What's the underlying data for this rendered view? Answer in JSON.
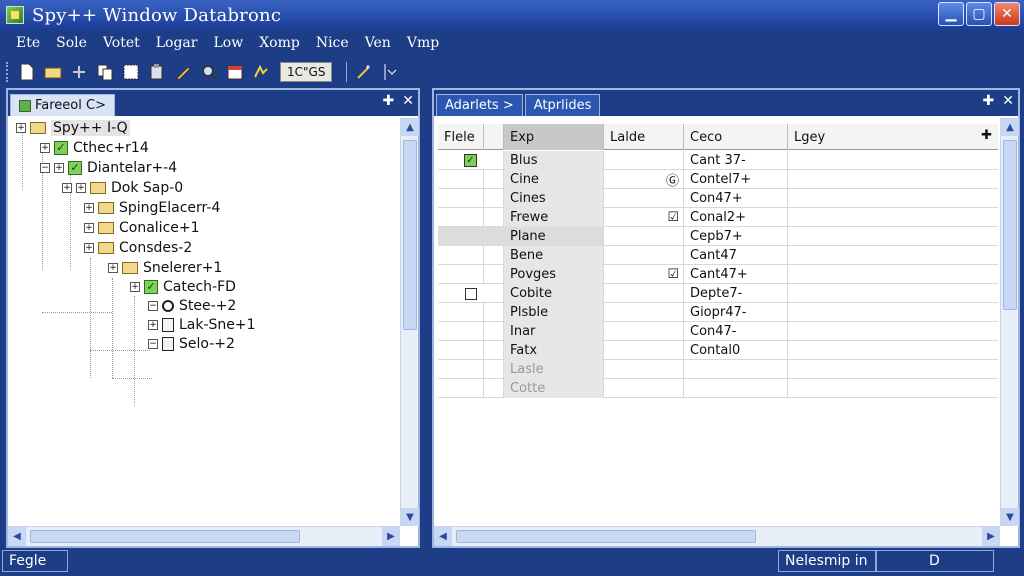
{
  "window": {
    "title": "Spy++ Window Databronc",
    "min_label": "▁",
    "max_label": "▢",
    "close_label": "✕"
  },
  "menu": [
    "Ete",
    "Sole",
    "Votet",
    "Logar",
    "Low",
    "Xomp",
    "Nice",
    "Ven",
    "Vmp"
  ],
  "toolbar": {
    "field_value": "1C\"GS",
    "icons": [
      "new-file-icon",
      "open-folder-icon",
      "plus-icon",
      "copy-icon",
      "window-icon",
      "paste-icon",
      "pencil-icon",
      "find-icon",
      "calendar-icon",
      "refresh-icon",
      "wand-icon",
      "dropdown-icon"
    ]
  },
  "left_panel": {
    "tab_label": "Fareeol C>",
    "ctrl_pin": "✚",
    "ctrl_close": "✕",
    "tree": [
      {
        "label": "Spy++ I-Q",
        "icon": "folder",
        "selected": true
      },
      {
        "label": "Cthec+r14",
        "icon": "check"
      },
      {
        "label": "Diantelar+-4",
        "icon": "check"
      },
      {
        "label": "Dok Sap-0",
        "icon": "folder"
      },
      {
        "label": "SpingElacerr-4",
        "icon": "folder"
      },
      {
        "label": "Conalice+1",
        "icon": "folder"
      },
      {
        "label": "Consdes-2",
        "icon": "folder"
      },
      {
        "label": "Snelerer+1",
        "icon": "folder"
      },
      {
        "label": "Catech-FD",
        "icon": "check"
      },
      {
        "label": "Stee-+2",
        "icon": "search"
      },
      {
        "label": "Lak-Sne+1",
        "icon": "doc"
      },
      {
        "label": "Selo-+2",
        "icon": "doc"
      }
    ]
  },
  "right_panel": {
    "tabs": [
      "Adarlets >",
      "Atprlides"
    ],
    "ctrl_pin": "✚",
    "ctrl_close": "✕",
    "columns": [
      "Flele",
      "Exp",
      "Lalde",
      "Ceco",
      "Lgey"
    ],
    "rows": [
      {
        "flag": "check",
        "exp": "Blus",
        "lalde": "",
        "ceco": "Cant 37-"
      },
      {
        "flag": "",
        "exp": "Cine",
        "lalde": "Ⓖ",
        "ceco": "Contel7+"
      },
      {
        "flag": "",
        "exp": "Cines",
        "lalde": "",
        "ceco": "Con47+"
      },
      {
        "flag": "",
        "exp": "Frewe",
        "lalde": "☑",
        "ceco": "Conal2+"
      },
      {
        "flag": "",
        "exp": "Plane",
        "lalde": "",
        "ceco": "Cepb7+"
      },
      {
        "flag": "",
        "exp": "Bene",
        "lalde": "",
        "ceco": "Cant47"
      },
      {
        "flag": "",
        "exp": "Povges",
        "lalde": "☑",
        "ceco": "Cant47+"
      },
      {
        "flag": "box",
        "exp": "Cobite",
        "lalde": "",
        "ceco": "Depte7-"
      },
      {
        "flag": "",
        "exp": "Plsble",
        "lalde": "",
        "ceco": "Giopr47-"
      },
      {
        "flag": "",
        "exp": "Inar",
        "lalde": "",
        "ceco": "Con47-"
      },
      {
        "flag": "",
        "exp": "Fatx",
        "lalde": "",
        "ceco": "Contal0"
      },
      {
        "flag": "",
        "exp": "Lasle",
        "lalde": "",
        "ceco": ""
      },
      {
        "flag": "",
        "exp": "Cotte",
        "lalde": "",
        "ceco": ""
      }
    ]
  },
  "status": {
    "left": "Fegle",
    "mid": "Nelesmip in",
    "right": "D"
  }
}
